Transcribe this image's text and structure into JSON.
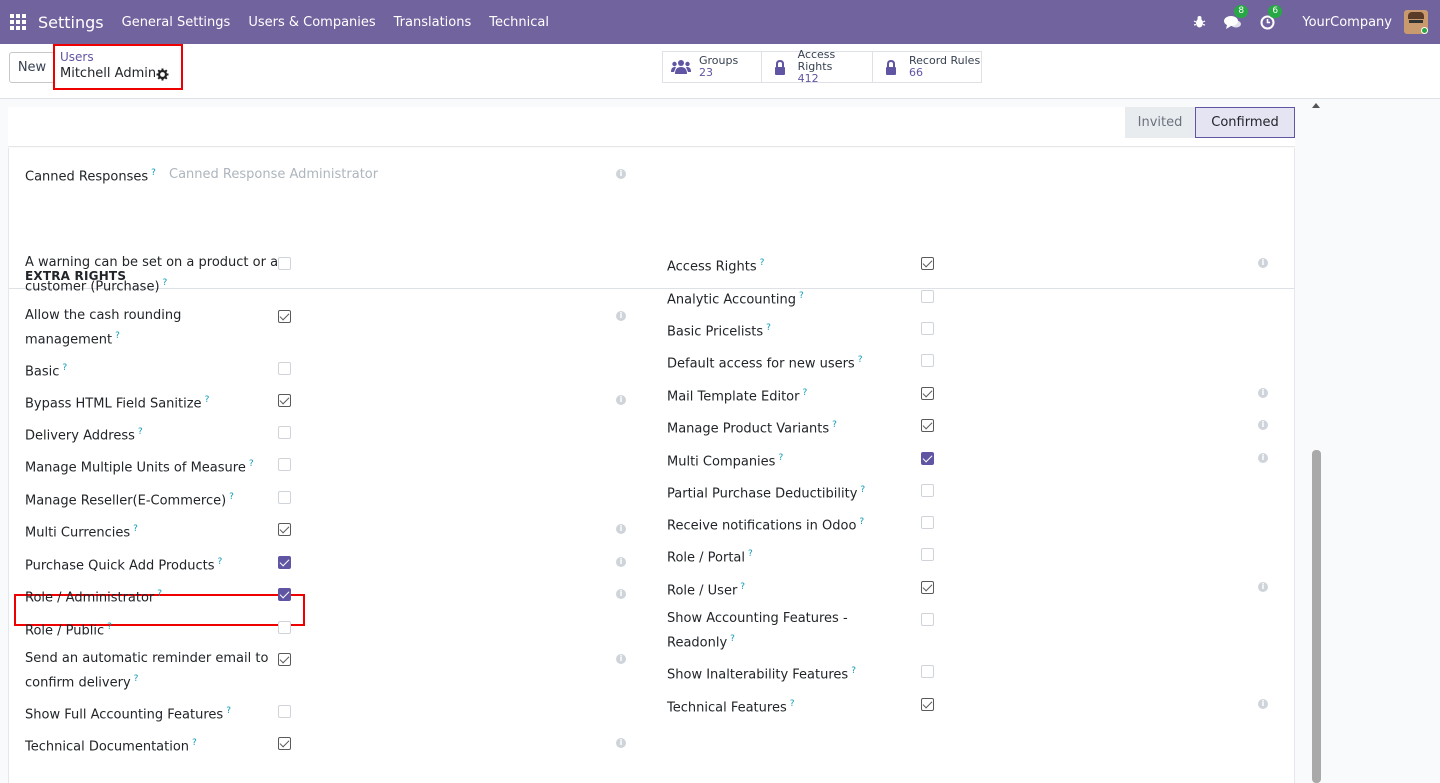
{
  "navbar": {
    "brand": "Settings",
    "menu": [
      "General Settings",
      "Users & Companies",
      "Translations",
      "Technical"
    ],
    "icons": {
      "debug": "bug-icon",
      "discuss": "chat-icon",
      "activity": "clock-icon"
    },
    "discuss_badge": "8",
    "activity_badge": "6",
    "company": "YourCompany"
  },
  "control": {
    "new_label": "New",
    "breadcrumb_parent": "Users",
    "breadcrumb_current": "Mitchell Admin",
    "smart_buttons": [
      {
        "label": "Groups",
        "value": "23",
        "icon": "users-icon"
      },
      {
        "label": "Access Rights",
        "value": "412",
        "icon": "lock-icon"
      },
      {
        "label": "Record Rules",
        "value": "66",
        "icon": "lock-icon"
      }
    ]
  },
  "status": {
    "stages": [
      "Invited",
      "Confirmed"
    ],
    "current": "Confirmed"
  },
  "form": {
    "canned_label": "Canned Responses",
    "canned_placeholder": "Canned Response Administrator",
    "section_title": "EXTRA RIGHTS",
    "left_column": [
      {
        "label_lines": [
          "A warning can be set on a product or a",
          "customer (Purchase)"
        ],
        "checked": false,
        "info": false
      },
      {
        "label_lines": [
          "Allow the cash rounding",
          "management"
        ],
        "checked": true,
        "info": true
      },
      {
        "label_lines": [
          "Basic"
        ],
        "checked": false,
        "info": false
      },
      {
        "label_lines": [
          "Bypass HTML Field Sanitize"
        ],
        "checked": true,
        "info": true
      },
      {
        "label_lines": [
          "Delivery Address"
        ],
        "checked": false,
        "info": false
      },
      {
        "label_lines": [
          "Manage Multiple Units of Measure"
        ],
        "checked": false,
        "info": false
      },
      {
        "label_lines": [
          "Manage Reseller(E-Commerce)"
        ],
        "checked": false,
        "info": false
      },
      {
        "label_lines": [
          "Multi Currencies"
        ],
        "checked": true,
        "info": true
      },
      {
        "label_lines": [
          "Purchase Quick Add Products"
        ],
        "checked": true,
        "filled": true,
        "info": true
      },
      {
        "label_lines": [
          "Role / Administrator"
        ],
        "checked": true,
        "filled": true,
        "info": true
      },
      {
        "label_lines": [
          "Role / Public"
        ],
        "checked": false,
        "info": false
      },
      {
        "label_lines": [
          "Send an automatic reminder email to",
          "confirm delivery"
        ],
        "checked": true,
        "info": true
      },
      {
        "label_lines": [
          "Show Full Accounting Features"
        ],
        "checked": false,
        "info": false
      },
      {
        "label_lines": [
          "Technical Documentation"
        ],
        "checked": true,
        "info": true
      }
    ],
    "right_column": [
      {
        "label_lines": [
          "Access Rights"
        ],
        "checked": true,
        "info": true
      },
      {
        "label_lines": [
          "Analytic Accounting"
        ],
        "checked": false,
        "info": false
      },
      {
        "label_lines": [
          "Basic Pricelists"
        ],
        "checked": false,
        "info": false
      },
      {
        "label_lines": [
          "Default access for new users"
        ],
        "checked": false,
        "info": false
      },
      {
        "label_lines": [
          "Mail Template Editor"
        ],
        "checked": true,
        "info": true
      },
      {
        "label_lines": [
          "Manage Product Variants"
        ],
        "checked": true,
        "info": true
      },
      {
        "label_lines": [
          "Multi Companies"
        ],
        "checked": true,
        "filled": true,
        "info": true
      },
      {
        "label_lines": [
          "Partial Purchase Deductibility"
        ],
        "checked": false,
        "info": false
      },
      {
        "label_lines": [
          "Receive notifications in Odoo"
        ],
        "checked": false,
        "info": false
      },
      {
        "label_lines": [
          "Role / Portal"
        ],
        "checked": false,
        "info": false
      },
      {
        "label_lines": [
          "Role / User"
        ],
        "checked": true,
        "info": true
      },
      {
        "label_lines": [
          "Show Accounting Features -",
          "Readonly"
        ],
        "checked": false,
        "info": false
      },
      {
        "label_lines": [
          "Show Inalterability Features"
        ],
        "checked": false,
        "info": false
      },
      {
        "label_lines": [
          "Technical Features"
        ],
        "checked": true,
        "info": true
      }
    ]
  }
}
